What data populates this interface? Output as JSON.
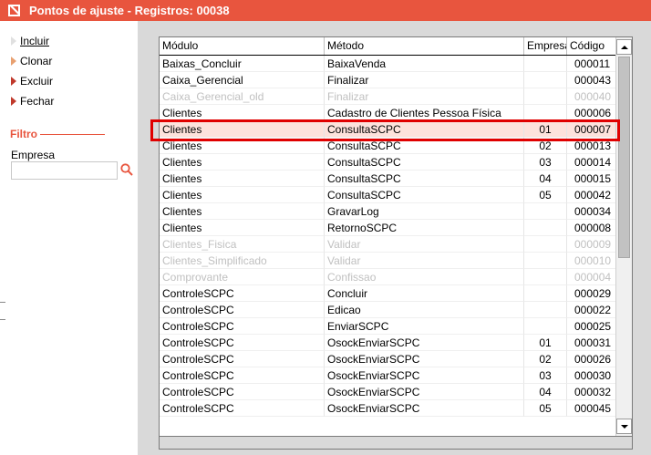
{
  "window": {
    "title": "Pontos de ajuste - Registros: 00038"
  },
  "sidebar": {
    "actions": [
      {
        "label": "Incluir",
        "icon": "arrow-gray-icon"
      },
      {
        "label": "Clonar",
        "icon": "arrow-orange-icon"
      },
      {
        "label": "Excluir",
        "icon": "arrow-red-icon"
      },
      {
        "label": "Fechar",
        "icon": "arrow-red-icon"
      }
    ],
    "filter": {
      "title": "Filtro",
      "empresa_label": "Empresa",
      "empresa_value": "",
      "search_icon": "search-icon"
    }
  },
  "table": {
    "columns": [
      "Módulo",
      "Método",
      "Empresa",
      "Código"
    ],
    "rows": [
      {
        "modulo": "Baixas_Concluir",
        "metodo": "BaixaVenda",
        "empresa": "",
        "codigo": "000011",
        "disabled": false,
        "selected": false
      },
      {
        "modulo": "Caixa_Gerencial",
        "metodo": "Finalizar",
        "empresa": "",
        "codigo": "000043",
        "disabled": false,
        "selected": false
      },
      {
        "modulo": "Caixa_Gerencial_old",
        "metodo": "Finalizar",
        "empresa": "",
        "codigo": "000040",
        "disabled": true,
        "selected": false
      },
      {
        "modulo": "Clientes",
        "metodo": "Cadastro de Clientes Pessoa Física",
        "empresa": "",
        "codigo": "000006",
        "disabled": false,
        "selected": false
      },
      {
        "modulo": "Clientes",
        "metodo": "ConsultaSCPC",
        "empresa": "01",
        "codigo": "000007",
        "disabled": false,
        "selected": true
      },
      {
        "modulo": "Clientes",
        "metodo": "ConsultaSCPC",
        "empresa": "02",
        "codigo": "000013",
        "disabled": false,
        "selected": false
      },
      {
        "modulo": "Clientes",
        "metodo": "ConsultaSCPC",
        "empresa": "03",
        "codigo": "000014",
        "disabled": false,
        "selected": false
      },
      {
        "modulo": "Clientes",
        "metodo": "ConsultaSCPC",
        "empresa": "04",
        "codigo": "000015",
        "disabled": false,
        "selected": false
      },
      {
        "modulo": "Clientes",
        "metodo": "ConsultaSCPC",
        "empresa": "05",
        "codigo": "000042",
        "disabled": false,
        "selected": false
      },
      {
        "modulo": "Clientes",
        "metodo": "GravarLog",
        "empresa": "",
        "codigo": "000034",
        "disabled": false,
        "selected": false
      },
      {
        "modulo": "Clientes",
        "metodo": "RetornoSCPC",
        "empresa": "",
        "codigo": "000008",
        "disabled": false,
        "selected": false
      },
      {
        "modulo": "Clientes_Fisica",
        "metodo": "Validar",
        "empresa": "",
        "codigo": "000009",
        "disabled": true,
        "selected": false
      },
      {
        "modulo": "Clientes_Simplificado",
        "metodo": "Validar",
        "empresa": "",
        "codigo": "000010",
        "disabled": true,
        "selected": false
      },
      {
        "modulo": "Comprovante",
        "metodo": "Confissao",
        "empresa": "",
        "codigo": "000004",
        "disabled": true,
        "selected": false
      },
      {
        "modulo": "ControleSCPC",
        "metodo": "Concluir",
        "empresa": "",
        "codigo": "000029",
        "disabled": false,
        "selected": false
      },
      {
        "modulo": "ControleSCPC",
        "metodo": "Edicao",
        "empresa": "",
        "codigo": "000022",
        "disabled": false,
        "selected": false
      },
      {
        "modulo": "ControleSCPC",
        "metodo": "EnviarSCPC",
        "empresa": "",
        "codigo": "000025",
        "disabled": false,
        "selected": false
      },
      {
        "modulo": "ControleSCPC",
        "metodo": "OsockEnviarSCPC",
        "empresa": "01",
        "codigo": "000031",
        "disabled": false,
        "selected": false
      },
      {
        "modulo": "ControleSCPC",
        "metodo": "OsockEnviarSCPC",
        "empresa": "02",
        "codigo": "000026",
        "disabled": false,
        "selected": false
      },
      {
        "modulo": "ControleSCPC",
        "metodo": "OsockEnviarSCPC",
        "empresa": "03",
        "codigo": "000030",
        "disabled": false,
        "selected": false
      },
      {
        "modulo": "ControleSCPC",
        "metodo": "OsockEnviarSCPC",
        "empresa": "04",
        "codigo": "000032",
        "disabled": false,
        "selected": false
      },
      {
        "modulo": "ControleSCPC",
        "metodo": "OsockEnviarSCPC",
        "empresa": "05",
        "codigo": "000045",
        "disabled": false,
        "selected": false
      }
    ]
  },
  "colors": {
    "accent": "#e8553e",
    "highlight_border": "#e00000",
    "selected_row": "#fde2dc",
    "disabled_text": "#c0c0c0"
  }
}
